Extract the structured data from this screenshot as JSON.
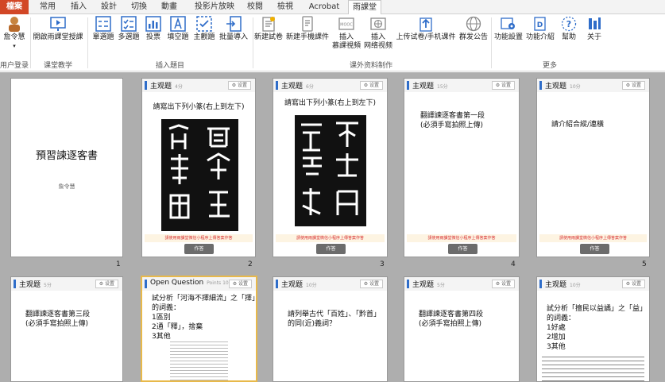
{
  "tabs": [
    "檔案",
    "常用",
    "插入",
    "設計",
    "切換",
    "動畫",
    "投影片放映",
    "校閱",
    "檢視",
    "Acrobat",
    "雨課堂"
  ],
  "ribbon": {
    "login": "詹令慧",
    "buttons": [
      "開啟雨課堂授課",
      "單選題",
      "多選題",
      "投票",
      "填空題",
      "主觀題",
      "批量導入",
      "新建試卷",
      "新建手機課件",
      "插入",
      "慕課視頻",
      "插入",
      "网络视频",
      "上传试卷/手机课件",
      "群发公告",
      "功能設置",
      "功能介紹",
      "幫助",
      "关于"
    ],
    "groups": [
      "用户登录",
      "课堂教学",
      "插入題目",
      "课外资料制作",
      "更多"
    ]
  },
  "slide1": {
    "title": "預習諫逐客書",
    "author": "詹令慧",
    "num": "1"
  },
  "qslides": [
    {
      "type": "主观题",
      "pts": "4分",
      "settings": "⚙ 设置",
      "q": "請寫出下列小篆(右上到左下)",
      "footer": "請使用雨課堂微信小程序上傳答案作答",
      "answer": "作答",
      "num": "2"
    },
    {
      "type": "主观题",
      "pts": "6分",
      "settings": "⚙ 设置",
      "q": "請寫出下列小篆(右上到左下)",
      "footer": "請使用雨課堂微信小程序上傳答案作答",
      "answer": "作答",
      "num": "3"
    },
    {
      "type": "主观题",
      "pts": "15分",
      "settings": "⚙ 设置",
      "q1": "翻譯諫逐客書第一段",
      "q2": "(必須手寫拍照上傳)",
      "footer": "請使用雨課堂微信小程序上傳答案作答",
      "answer": "作答",
      "num": "4"
    },
    {
      "type": "主观题",
      "pts": "10分",
      "settings": "⚙ 设置",
      "q": "請介紹合縱/連橫",
      "footer": "請使用雨課堂微信小程序上傳答案作答",
      "answer": "作答",
      "num": "5"
    }
  ],
  "row2": [
    {
      "type": "主观题",
      "pts": "5分",
      "settings": "⚙ 设置",
      "q1": "翻譯諫逐客書第三段",
      "q2": "(必須手寫拍照上傳)"
    },
    {
      "type": "Open Question",
      "pts": "Points 10",
      "settings": "⚙ 设置",
      "q1": "試分析「河海不擇細流」之「擇」",
      "q2": "的詞義：",
      "q3": "1區別",
      "q4": "2通「釋」，捨棄",
      "q5": "3其他"
    },
    {
      "type": "主观题",
      "pts": "10分",
      "settings": "⚙ 设置",
      "q1": "請列舉古代「百姓」、「黔首」",
      "q2": "的同(近)義詞？"
    },
    {
      "type": "主观题",
      "pts": "5分",
      "settings": "⚙ 设置",
      "q1": "翻譯諫逐客書第四段",
      "q2": "(必須手寫拍照上傳)"
    },
    {
      "type": "主观题",
      "pts": "10分",
      "settings": "⚙ 设置",
      "q1": "試分析「擅民以益譎」之「益」",
      "q2": "的詞義：",
      "q3": "1好處",
      "q4": "2增加",
      "q5": "3其他"
    }
  ]
}
